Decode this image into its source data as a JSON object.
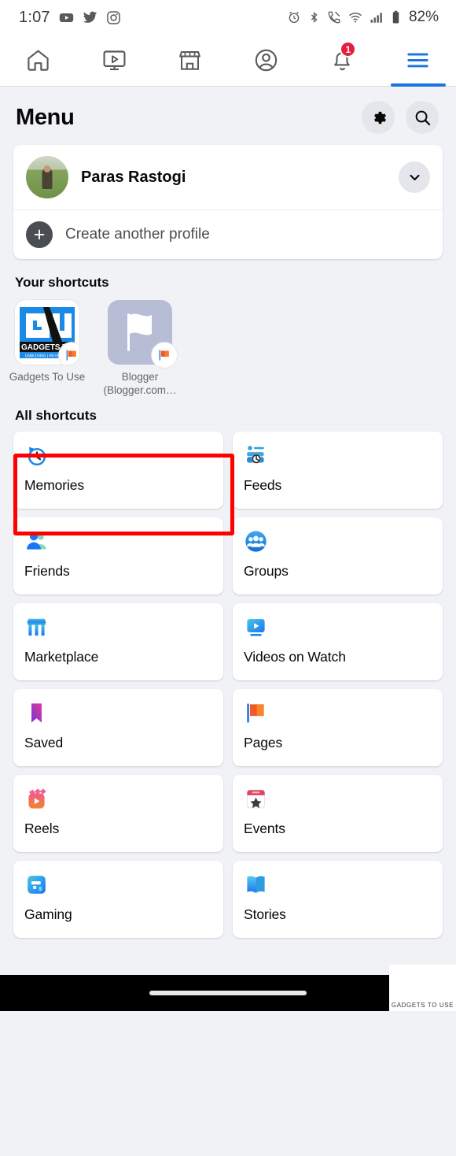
{
  "status_bar": {
    "time": "1:07",
    "left_icons": [
      "youtube-icon",
      "twitter-icon",
      "instagram-icon"
    ],
    "right_icons": [
      "alarm-icon",
      "bluetooth-icon",
      "call-mute-icon",
      "wifi-icon",
      "cellular-signal-icon",
      "battery-icon"
    ],
    "battery_percent": "82%"
  },
  "tab_bar": {
    "tabs": [
      {
        "name": "home-tab",
        "icon": "home-icon",
        "active": false,
        "badge": ""
      },
      {
        "name": "video-tab",
        "icon": "video-icon",
        "active": false,
        "badge": ""
      },
      {
        "name": "marketplace-tab",
        "icon": "store-icon",
        "active": false,
        "badge": ""
      },
      {
        "name": "profile-tab",
        "icon": "person-circle-icon",
        "active": false,
        "badge": ""
      },
      {
        "name": "notifications-tab",
        "icon": "bell-icon",
        "active": false,
        "badge": "1"
      },
      {
        "name": "menu-tab",
        "icon": "hamburger-icon",
        "active": true,
        "badge": ""
      }
    ]
  },
  "header": {
    "title": "Menu",
    "settings_icon": "gear-icon",
    "search_icon": "search-icon"
  },
  "profile_card": {
    "name": "Paras Rastogi",
    "avatar": "user-avatar",
    "expand_icon": "chevron-down-icon",
    "create_label": "Create another profile",
    "create_icon": "plus-icon"
  },
  "your_shortcuts": {
    "title": "Your shortcuts",
    "items": [
      {
        "label": "Gadgets To Use",
        "icon": "gadgets-to-use-logo",
        "badge_icon": "page-flag-icon"
      },
      {
        "label": "Blogger (Blogger.com…",
        "icon": "blogger-flag-logo",
        "badge_icon": "page-flag-icon"
      }
    ]
  },
  "all_shortcuts": {
    "title": "All shortcuts",
    "items": [
      {
        "label": "Memories",
        "icon": "memories-clock-icon",
        "highlighted": true
      },
      {
        "label": "Feeds",
        "icon": "feeds-icon",
        "highlighted": false
      },
      {
        "label": "Friends",
        "icon": "friends-icon",
        "highlighted": false
      },
      {
        "label": "Groups",
        "icon": "groups-icon",
        "highlighted": false
      },
      {
        "label": "Marketplace",
        "icon": "marketplace-icon",
        "highlighted": false
      },
      {
        "label": "Videos on Watch",
        "icon": "watch-video-icon",
        "highlighted": false
      },
      {
        "label": "Saved",
        "icon": "bookmark-icon",
        "highlighted": false
      },
      {
        "label": "Pages",
        "icon": "pages-flag-icon",
        "highlighted": false
      },
      {
        "label": "Reels",
        "icon": "reels-icon",
        "highlighted": false
      },
      {
        "label": "Events",
        "icon": "events-calendar-icon",
        "highlighted": false
      },
      {
        "label": "Gaming",
        "icon": "gaming-controller-icon",
        "highlighted": false
      },
      {
        "label": "Stories",
        "icon": "stories-book-icon",
        "highlighted": false
      }
    ]
  },
  "watermark": {
    "text": "GADGETS TO USE"
  },
  "colors": {
    "accent": "#1b74e4",
    "highlight": "#ff0000",
    "badge": "#e41e3f",
    "page_bg": "#f0f2f5"
  }
}
